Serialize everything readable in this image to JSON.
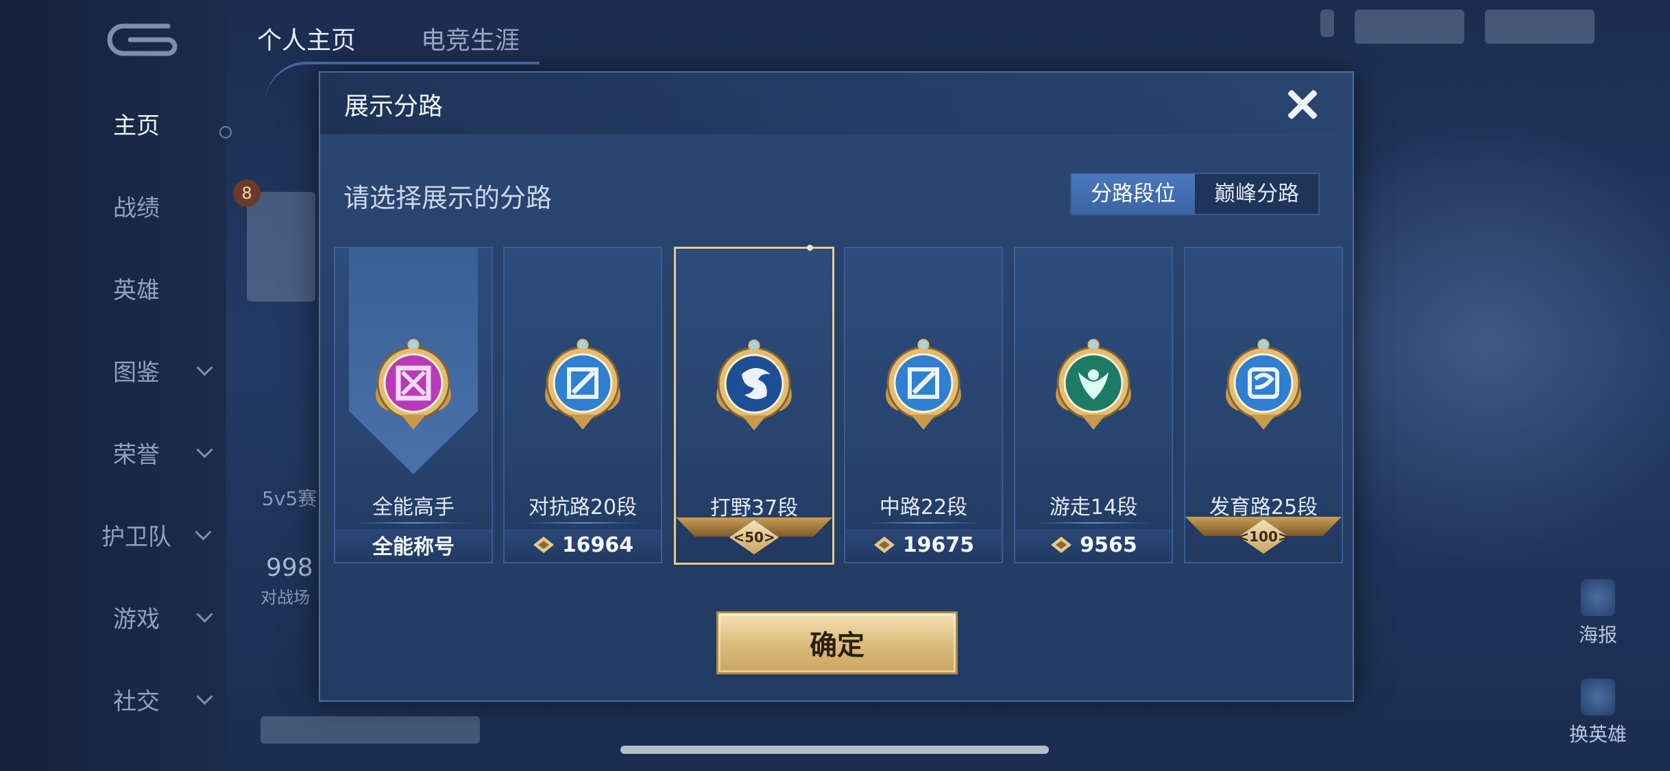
{
  "background": {
    "top_tabs": [
      "个人主页",
      "电竞生涯"
    ],
    "nav": [
      {
        "label": "主页",
        "active": true,
        "has_chevron": false
      },
      {
        "label": "战绩",
        "active": false,
        "has_chevron": false
      },
      {
        "label": "英雄",
        "active": false,
        "has_chevron": false
      },
      {
        "label": "图鉴",
        "active": false,
        "has_chevron": true
      },
      {
        "label": "荣誉",
        "active": false,
        "has_chevron": true
      },
      {
        "label": "护卫队",
        "active": false,
        "has_chevron": true
      },
      {
        "label": "游戏",
        "active": false,
        "has_chevron": true
      },
      {
        "label": "社交",
        "active": false,
        "has_chevron": true
      }
    ],
    "level_badge": "8",
    "season_text": "5v5赛",
    "stat_number": "998",
    "stat_label": "对战场",
    "side_actions": [
      "海报",
      "换英雄"
    ]
  },
  "modal": {
    "title": "展示分路",
    "subtitle": "请选择展示的分路",
    "segments": [
      {
        "label": "分路段位",
        "active": true
      },
      {
        "label": "巅峰分路",
        "active": false
      }
    ],
    "cards": [
      {
        "name": "全能高手",
        "footer": "全能称号",
        "footer_type": "text",
        "emblem": "all-round-emblem-icon",
        "color": "#b83ab8",
        "selected": false
      },
      {
        "name": "对抗路20段",
        "footer": "16964",
        "footer_type": "points",
        "emblem": "clash-lane-emblem-icon",
        "color": "#2f7fd2",
        "selected": false
      },
      {
        "name": "打野37段",
        "footer": "50",
        "footer_type": "star",
        "emblem": "jungle-emblem-icon",
        "color": "#1d4f96",
        "selected": true
      },
      {
        "name": "中路22段",
        "footer": "19675",
        "footer_type": "points",
        "emblem": "mid-lane-emblem-icon",
        "color": "#2f7fd2",
        "selected": false
      },
      {
        "name": "游走14段",
        "footer": "9565",
        "footer_type": "points",
        "emblem": "roam-emblem-icon",
        "color": "#1d7a66",
        "selected": false
      },
      {
        "name": "发育路25段",
        "footer": "100",
        "footer_type": "star",
        "emblem": "farm-lane-emblem-icon",
        "color": "#2f7fd2",
        "selected": false
      }
    ],
    "confirm_label": "确定"
  },
  "colors": {
    "accent_gold": "#e9c98a",
    "panel": "#27416b"
  }
}
